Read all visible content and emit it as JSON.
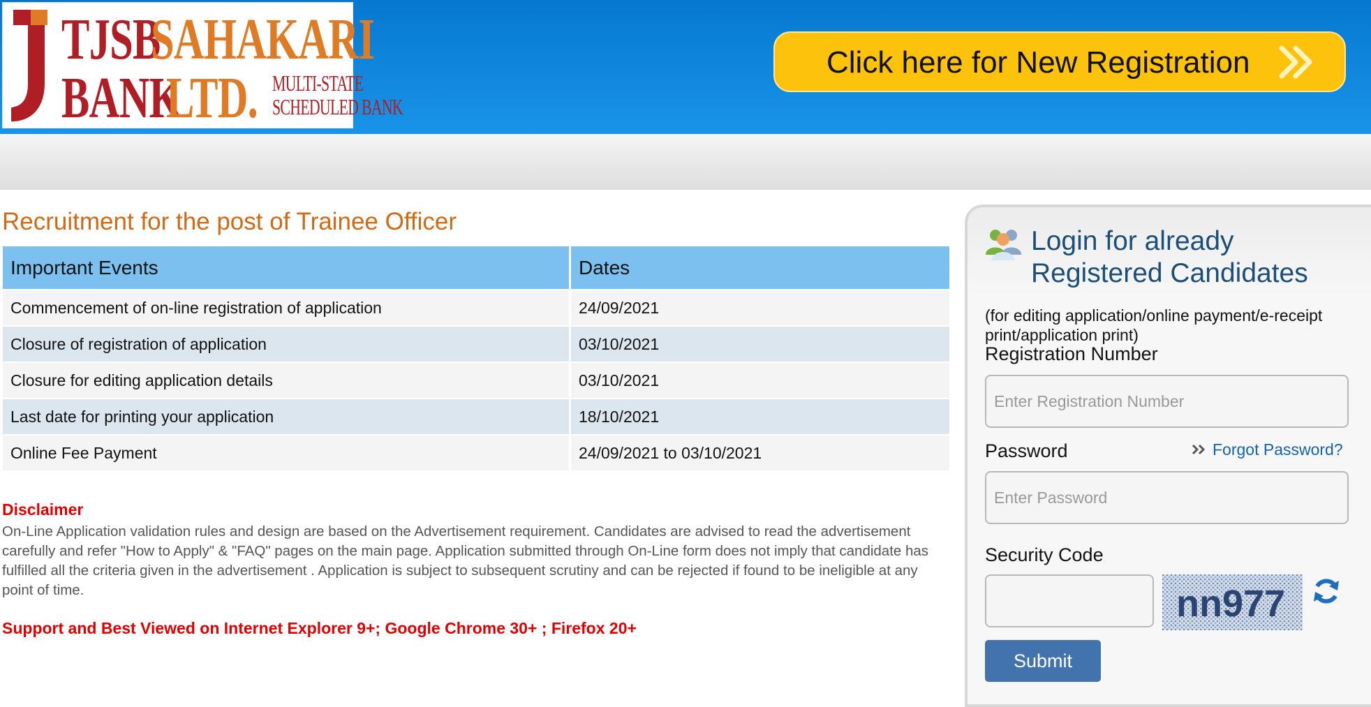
{
  "logo": {
    "line1_a": "TJSB",
    "line1_b": "SAHAKARI",
    "line2_a": "BANK",
    "line2_b": "LTD.",
    "tag1": "MULTI-STATE",
    "tag2": "SCHEDULED BANK"
  },
  "header": {
    "register_label": "Click here for New Registration",
    "register_icon": "double-chevron-right-icon"
  },
  "main": {
    "title": "Recruitment for the post of Trainee Officer",
    "table": {
      "headers": [
        "Important Events",
        "Dates"
      ],
      "rows": [
        [
          "Commencement of on-line registration of application",
          "24/09/2021"
        ],
        [
          "Closure of registration of application",
          "03/10/2021"
        ],
        [
          "Closure for editing application details",
          "03/10/2021"
        ],
        [
          "Last date for printing your application",
          "18/10/2021"
        ],
        [
          "Online Fee Payment",
          "24/09/2021 to 03/10/2021"
        ]
      ]
    },
    "disclaimer_title": "Disclaimer",
    "disclaimer_body": "On-Line Application validation rules and design are based on the Advertisement requirement. Candidates are advised to read the advertisement carefully and refer \"How to Apply\" & \"FAQ\" pages on the main page. Application submitted through On-Line form does not imply that candidate has fulfilled all the criteria given in the advertisement . Application is subject to subsequent scrutiny and can be rejected if found to be ineligible at any point of time.",
    "support": "Support and Best Viewed on Internet Explorer 9+; Google Chrome 30+ ; Firefox 20+"
  },
  "login": {
    "title_line1": "Login for already",
    "title_line2": "Registered Candidates",
    "subtitle": "(for editing application/online payment/e-receipt print/application print)",
    "reg_label": "Registration Number",
    "reg_placeholder": "Enter Registration Number",
    "password_label": "Password",
    "forgot_label": "Forgot Password?",
    "password_placeholder": "Enter Password",
    "security_label": "Security Code",
    "security_value": "",
    "captcha_text": "nn977",
    "submit_label": "Submit",
    "icons": [
      "users-icon",
      "refresh-icon"
    ]
  },
  "colors": {
    "header_blue": "#0678cf",
    "register_yellow": "#fdc20c",
    "title_orange": "#d06a16",
    "table_header": "#7cc0f0",
    "alert_red": "#e00000",
    "link_blue": "#1463a8",
    "submit_blue": "#4273ad"
  }
}
